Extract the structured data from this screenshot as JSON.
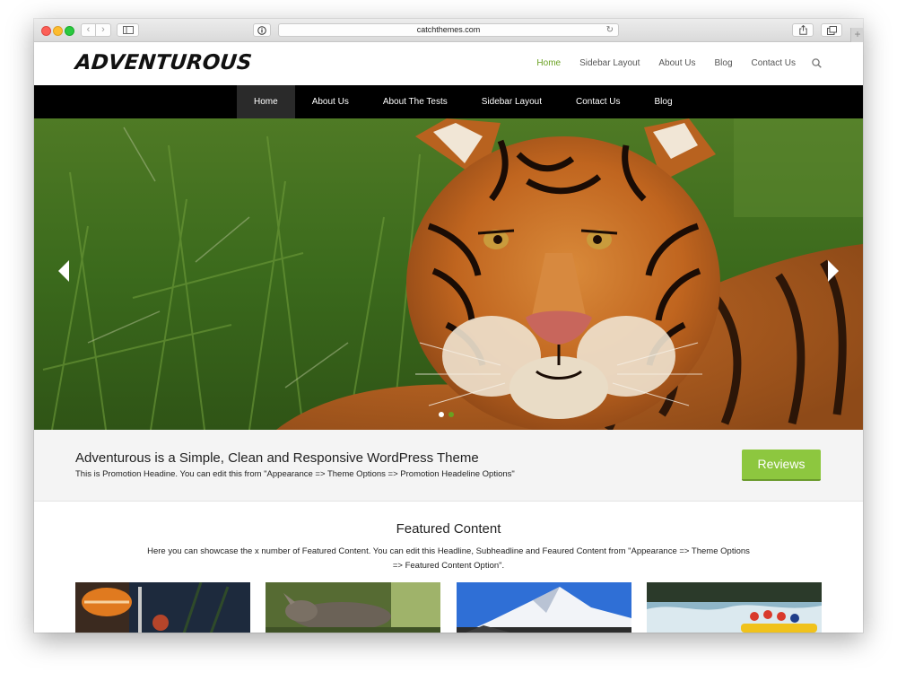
{
  "browser": {
    "url": "catchthemes.com",
    "reload_glyph": "↻",
    "back_glyph": "‹",
    "forward_glyph": "›",
    "newtab_glyph": "+"
  },
  "site": {
    "logo": "ADVENTUROUS",
    "top_nav": [
      "Home",
      "Sidebar Layout",
      "About Us",
      "Blog",
      "Contact Us"
    ],
    "main_menu": [
      "Home",
      "About Us",
      "About The Tests",
      "Sidebar Layout",
      "Contact Us",
      "Blog"
    ],
    "active_menu": "Home"
  },
  "slider": {
    "slide_count": 2,
    "active_slide": 1
  },
  "promotion": {
    "title": "Adventurous is a Simple, Clean and Responsive WordPress Theme",
    "subtitle": "This is Promotion Headine. You can edit this from \"Appearance => Theme Options => Promotion Headeline Options\"",
    "button_label": "Reviews"
  },
  "featured": {
    "title": "Featured Content",
    "description_line1": "Here you can showcase the x number of Featured Content. You can edit this Headline, Subheadline and Feaured Content from \"Appearance => Theme Options",
    "description_line2": "=> Featured Content Option\"."
  },
  "colors": {
    "accent": "#6aa121",
    "button": "#8dc73f",
    "menu_bg": "#000000"
  }
}
